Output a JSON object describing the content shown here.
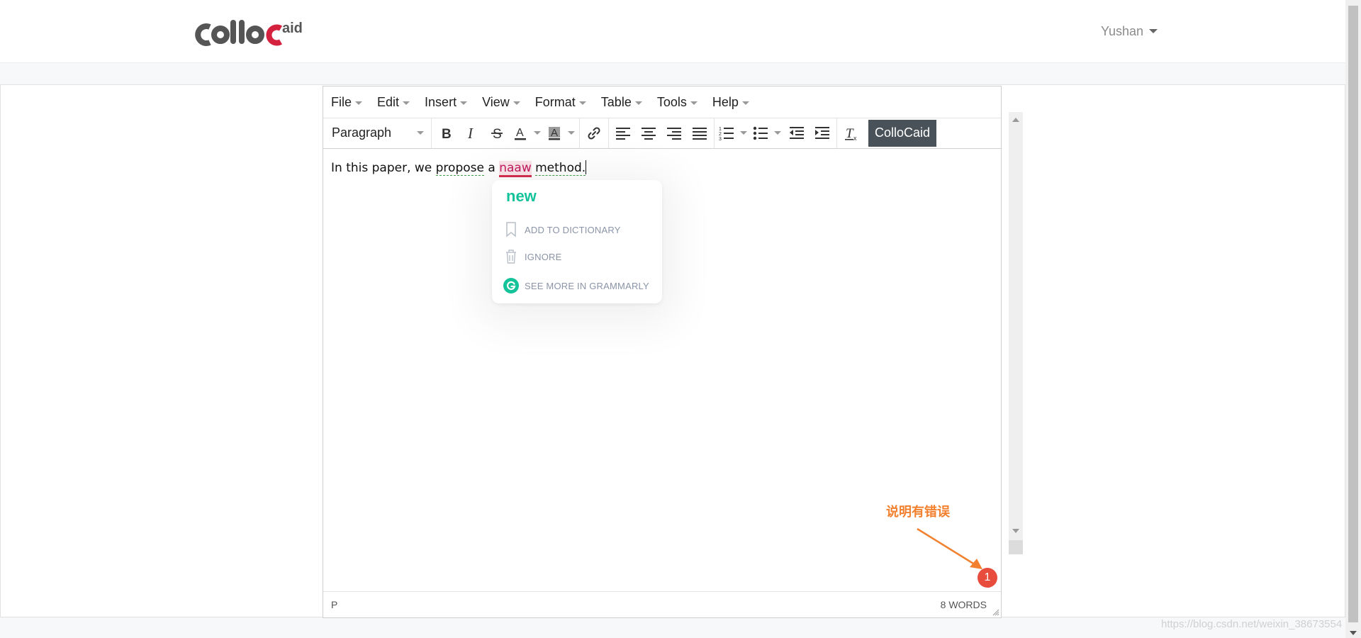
{
  "navbar": {
    "logo_text": "ColloCaid",
    "user_name": "Yushan"
  },
  "editor": {
    "menus": [
      "File",
      "Edit",
      "Insert",
      "View",
      "Format",
      "Table",
      "Tools",
      "Help"
    ],
    "block_format": "Paragraph",
    "toolbar_icons": [
      "bold-icon",
      "italic-icon",
      "strikethrough-icon",
      "text-color-icon",
      "background-color-icon",
      "link-icon",
      "align-left-icon",
      "align-center-icon",
      "align-right-icon",
      "align-justify-icon",
      "numbered-list-icon",
      "bullet-list-icon",
      "outdent-icon",
      "indent-icon",
      "clear-formatting-icon"
    ],
    "plugin_button": "ColloCaid",
    "content": {
      "before": "In this paper, we ",
      "w_propose": "propose",
      "mid": " a ",
      "w_error": "naaw",
      "space": " ",
      "w_method": "method."
    },
    "status_path": "P",
    "word_count": "8 WORDS"
  },
  "grammarly": {
    "suggestion": "new",
    "add_to_dictionary": "ADD TO DICTIONARY",
    "ignore": "IGNORE",
    "see_more": "SEE MORE IN GRAMMARLY",
    "brand_color": "#15c39a"
  },
  "annotation": {
    "text": "说明有错误",
    "badge_count": "1",
    "color": "#f2802e",
    "badge_color": "#e74c3c"
  },
  "watermark": "https://blog.csdn.net/weixin_38673554"
}
